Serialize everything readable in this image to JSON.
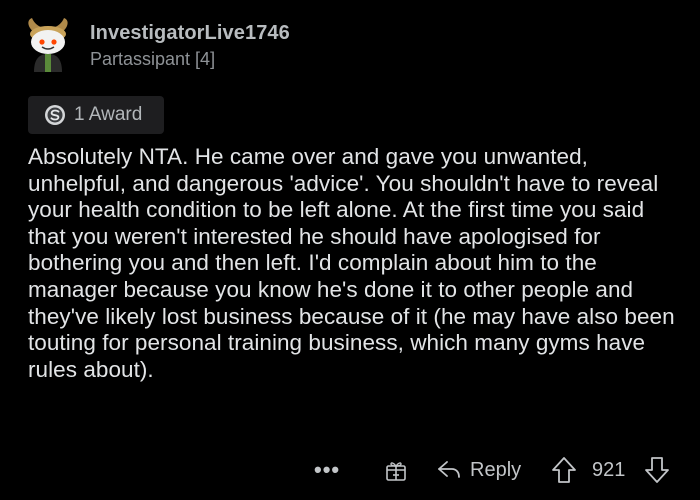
{
  "comment_card": {
    "username": "InvestigatorLive1746",
    "flair": "Partassipant [4]",
    "award_count_label": "1 Award",
    "body": "Absolutely NTA. He came over and gave you unwanted, unhelpful, and dangerous 'advice'. You shouldn't have to reveal your health condition to be left alone. At the first time you said that you weren't interested he should have apologised for bothering you and then left. I'd complain about him to the manager because you know he's done it to other people and they've likely lost business because of it (he may have also been touting for personal training business, which many gyms have rules about)."
  },
  "actions": {
    "more_label": "•••",
    "reply_label": "Reply",
    "vote_count": "921",
    "icons": [
      "more-icon",
      "gift-icon",
      "reply-icon",
      "upvote-icon",
      "downvote-icon"
    ]
  },
  "colors": {
    "background": "#000000",
    "text": "#e2e4e6",
    "muted": "#8e9296",
    "award_bg": "#1e1e20"
  }
}
